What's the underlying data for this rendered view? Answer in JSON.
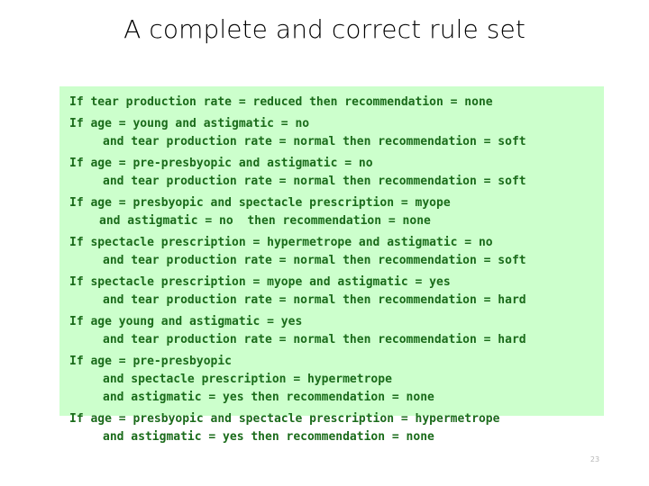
{
  "slide": {
    "title": "A complete and correct rule set",
    "page_number": "23",
    "colors": {
      "box_background": "#ccffcc",
      "rule_text": "#1a6b1a",
      "title_text": "#000000",
      "page_number_text": "#b5b5b5",
      "slide_background": "#ffffff"
    }
  },
  "rules": [
    {
      "lines": [
        {
          "text": "If tear production rate = reduced then recommendation = none",
          "indent": "none"
        }
      ]
    },
    {
      "lines": [
        {
          "text": "If age = young and astigmatic = no",
          "indent": "none"
        },
        {
          "text": "and tear production rate = normal then recommendation = soft",
          "indent": "cont"
        }
      ]
    },
    {
      "lines": [
        {
          "text": "If age = pre-presbyopic and astigmatic = no",
          "indent": "none"
        },
        {
          "text": "and tear production rate = normal then recommendation = soft",
          "indent": "cont"
        }
      ]
    },
    {
      "lines": [
        {
          "text": "If age = presbyopic and spectacle prescription = myope",
          "indent": "none"
        },
        {
          "text": "and astigmatic = no  then recommendation = none",
          "indent": "cont-tight"
        }
      ]
    },
    {
      "lines": [
        {
          "text": "If spectacle prescription = hypermetrope and astigmatic = no",
          "indent": "none"
        },
        {
          "text": "and tear production rate = normal then recommendation = soft",
          "indent": "cont"
        }
      ]
    },
    {
      "lines": [
        {
          "text": "If spectacle prescription = myope and astigmatic = yes",
          "indent": "none"
        },
        {
          "text": "and tear production rate = normal then recommendation = hard",
          "indent": "cont"
        }
      ]
    },
    {
      "lines": [
        {
          "text": "If age young and astigmatic = yes",
          "indent": "none"
        },
        {
          "text": "and tear production rate = normal then recommendation = hard",
          "indent": "cont"
        }
      ]
    },
    {
      "lines": [
        {
          "text": "If age = pre-presbyopic",
          "indent": "none"
        },
        {
          "text": "and spectacle prescription = hypermetrope",
          "indent": "cont"
        },
        {
          "text": "and astigmatic = yes then recommendation = none",
          "indent": "cont"
        }
      ]
    },
    {
      "lines": [
        {
          "text": "If age = presbyopic and spectacle prescription = hypermetrope",
          "indent": "none"
        },
        {
          "text": "and astigmatic = yes then recommendation = none",
          "indent": "cont"
        }
      ]
    }
  ]
}
